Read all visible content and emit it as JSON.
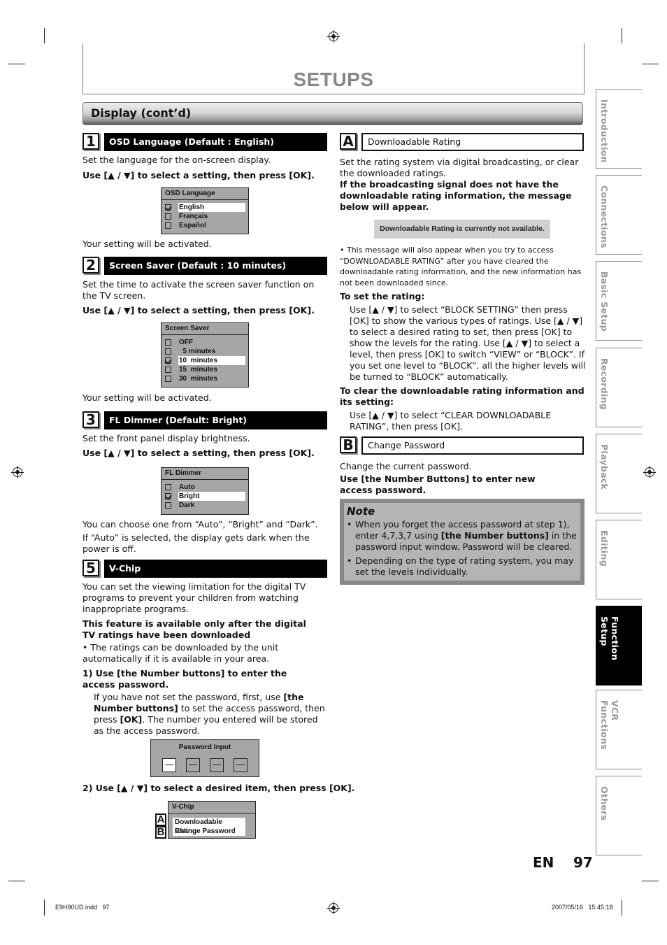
{
  "page": {
    "title": "SETUPS",
    "section": "Display (cont’d)",
    "lang": "EN",
    "page_number": "97",
    "footer_file": "E9H90UD.indd   97",
    "footer_timestamp": "2007/05/16   15:45:18"
  },
  "side_tabs": [
    {
      "label": "Introduction",
      "active": false
    },
    {
      "label": "Connections",
      "active": false
    },
    {
      "label": "Basic Setup",
      "active": false
    },
    {
      "label": "Recording",
      "active": false
    },
    {
      "label": "Playback",
      "active": false
    },
    {
      "label": "Editing",
      "active": false
    },
    {
      "label": "Function Setup",
      "active": true
    },
    {
      "label": "VCR Functions",
      "active": false
    },
    {
      "label": "Others",
      "active": false
    }
  ],
  "steps": {
    "s1": {
      "num": "1",
      "heading": "OSD Language (Default : English)",
      "desc": "Set the language for the on-screen display.",
      "instruction": "Use [▲ / ▼] to select a setting, then press [OK].",
      "menu": {
        "title": "OSD Language",
        "items": [
          "English",
          "Français",
          "Español"
        ],
        "selected": 0
      },
      "after": "Your setting will be activated."
    },
    "s2": {
      "num": "2",
      "heading": "Screen Saver (Default : 10 minutes)",
      "desc": "Set the time to activate the screen saver function on the TV screen.",
      "instruction": "Use [▲ / ▼] to select a setting, then press [OK].",
      "menu": {
        "title": "Screen Saver",
        "items": [
          "OFF",
          "  5 minutes",
          "10  minutes",
          "15  minutes",
          "30  minutes"
        ],
        "selected": 2
      },
      "after": "Your setting will be activated."
    },
    "s3": {
      "num": "3",
      "heading": "FL Dimmer (Default: Bright)",
      "desc": "Set the front panel display brightness.",
      "instruction": "Use [▲ / ▼] to select a setting, then press [OK].",
      "menu": {
        "title": "FL Dimmer",
        "items": [
          "Auto",
          "Bright",
          "Dark"
        ],
        "selected": 1
      },
      "after1": "You can choose one from “Auto”, “Bright” and “Dark”.",
      "after2": "If “Auto” is selected, the display gets dark when the power is off."
    },
    "s5": {
      "num": "5",
      "heading": "V-Chip",
      "desc": "You can set the viewing limitation for the digital TV programs to prevent your children from watching inappropriate programs.",
      "bold_note": "This feature is available only after the digital TV ratings have been downloaded",
      "bullet": "• The ratings can be downloaded by the unit automatically if it is available in your area.",
      "step1_title": "1) Use [the Number buttons] to enter the access password.",
      "step1_body_a": "If you have not set the password, first, use ",
      "step1_body_b": "[the Number buttons]",
      "step1_body_c": " to set the access password, then press ",
      "step1_body_d": "[OK]",
      "step1_body_e": ". The number you entered will be stored as the access password.",
      "password_title": "Password Input",
      "step2_title": "2) Use [▲ / ▼] to select a desired item, then press [OK].",
      "vchip_menu": {
        "title": "V-Chip",
        "items": [
          "Downloadable Rating",
          "Change Password"
        ],
        "tags": [
          "A",
          "B"
        ],
        "selected": 0
      }
    }
  },
  "right": {
    "a": {
      "tag": "A",
      "heading": "Downloadable Rating",
      "desc": "Set the rating system via digital broadcasting, or clear the downloaded ratings.",
      "bold": "If the broadcasting signal does not have the downloadable rating information, the message below will appear.",
      "message": "Downloadable Rating is currently not available.",
      "bullet": "• This message will also appear when you try to access “DOWNLOADABLE RATING” after you have cleared the downloadable rating information, and the new information has not been downloaded since.",
      "set_title": "To set the rating:",
      "set_body": "Use [▲ / ▼] to select “BLOCK SETTING” then press [OK] to show the various types of ratings. Use [▲ / ▼] to select a desired rating to set, then press [OK] to show the levels for the rating. Use [▲ / ▼] to select a level, then press [OK] to switch “VIEW” or “BLOCK”. If you set one level to “BLOCK”, all the higher levels will be turned to “BLOCK” automatically.",
      "clear_title": "To clear the downloadable rating information and its setting:",
      "clear_body": "Use [▲ / ▼] to select “CLEAR DOWNLOADABLE RATING”, then press [OK]."
    },
    "b": {
      "tag": "B",
      "heading": "Change Password",
      "desc": "Change the current password.",
      "bold": "Use [the Number Buttons] to enter new access password."
    },
    "note": {
      "title": "Note",
      "b1a": "When you forget the access password at step 1), enter 4,7,3,7 using ",
      "b1b": "[the Number buttons]",
      "b1c": " in the password input window. Password will be cleared.",
      "b2": "Depending on the type of rating system, you may set the levels individually."
    }
  }
}
